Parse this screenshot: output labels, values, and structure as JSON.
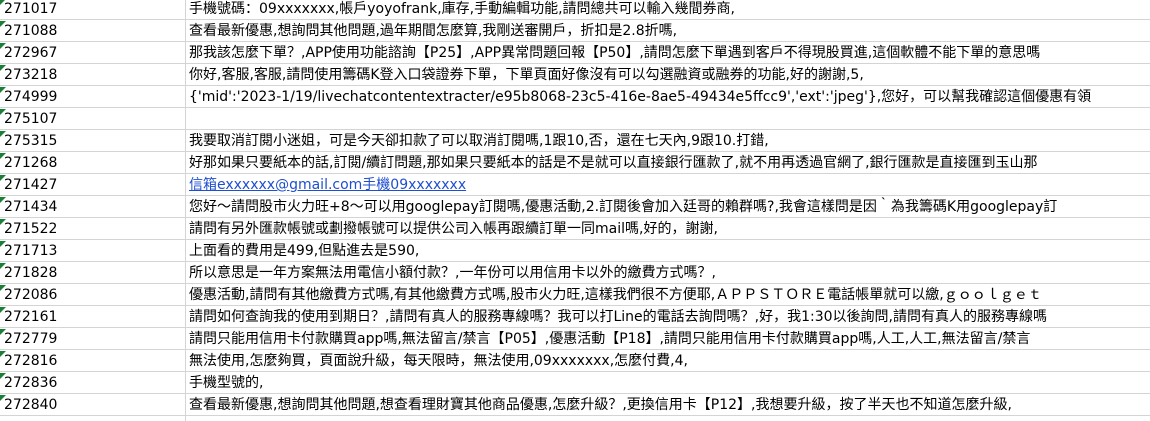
{
  "rows": [
    {
      "id": "271017",
      "text": "手機號碼：09xxxxxxx,帳戶yoyofrank,庫存,手動編輯功能,請問總共可以輸入幾間券商,"
    },
    {
      "id": "271088",
      "text": "查看最新優惠,想詢問其他問題,過年期間怎麼算,我剛送審開戶，折扣是2.8折嗎,"
    },
    {
      "id": "272967",
      "text": "那我該怎麼下單？,APP使用功能諮詢【P25】,APP異常問題回報【P50】,請問怎麼下單遇到客戶不得現股買進,這個軟體不能下單的意思嗎"
    },
    {
      "id": "273218",
      "text": "你好,客服,客服,請問使用籌碼K登入口袋證券下單，下單頁面好像沒有可以勾選融資或融券的功能,好的謝謝,5,"
    },
    {
      "id": "274999",
      "text": "{'mid':'2023-1/19/livechatcontentextracter/e95b8068-23c5-416e-8ae5-49434e5ffcc9','ext':'jpeg'},您好，可以幫我確認這個優惠有領"
    },
    {
      "id": "275107",
      "text": ""
    },
    {
      "id": "275315",
      "text": "我要取消訂閱小迷姐，可是今天卻扣款了可以取消訂閱嗎,1跟10,否，還在七天內,9跟10.打錯,"
    },
    {
      "id": "271268",
      "text": "好那如果只要紙本的話,訂閱/續訂問題,那如果只要紙本的話是不是就可以直接銀行匯款了,就不用再透過官網了,銀行匯款是直接匯到玉山那"
    },
    {
      "id": "271427",
      "text": "信箱exxxxxx@gmail.com手機09xxxxxxx",
      "link": true
    },
    {
      "id": "271434",
      "text": "您好～請問股市火力旺+8～可以用googlepay訂閱嗎,優惠活動,2.訂閱後會加入廷哥的賴群嗎?,我會這樣問是因｀為我籌碼K用googlepay訂"
    },
    {
      "id": "271522",
      "text": "請問有另外匯款帳號或劃撥帳號可以提供公司入帳再跟續訂單一同mail嗎,好的，謝謝,"
    },
    {
      "id": "271713",
      "text": "上面看的費用是499,但點進去是590,"
    },
    {
      "id": "271828",
      "text": "所以意思是一年方案無法用電信小額付款？,一年份可以用信用卡以外的繳費方式嗎？,"
    },
    {
      "id": "272086",
      "text": "優惠活動,請問有其他繳費方式嗎,有其他繳費方式嗎,股市火力旺,這樣我們很不方便耶,ＡＰＰＳＴＯＲＥ電話帳單就可以繳,ｇｏｏｌｇｅｔ"
    },
    {
      "id": "272161",
      "text": "請問如何查詢我的使用到期日？,請問有真人的服務專線嗎？我可以打Line的電話去詢問嗎？,好，我1:30以後詢問,請問有真人的服務專線嗎"
    },
    {
      "id": "272779",
      "text": "請問只能用信用卡付款購買app嗎,無法留言/禁言【P05】,優惠活動【P18】,請問只能用信用卡付款購買app嗎,人工,人工,無法留言/禁言"
    },
    {
      "id": "272816",
      "text": "無法使用,怎麼夠買，頁面說升級，每天限時，無法使用,09xxxxxxx,怎麼付費,4,"
    },
    {
      "id": "272836",
      "text": "手機型號的,"
    },
    {
      "id": "272840",
      "text": "查看最新優惠,想詢問其他問題,想查看理財寶其他商品優惠,怎麼升級？,更換信用卡【P12】,我想要升級，按了半天也不知道怎麼升級,"
    }
  ]
}
